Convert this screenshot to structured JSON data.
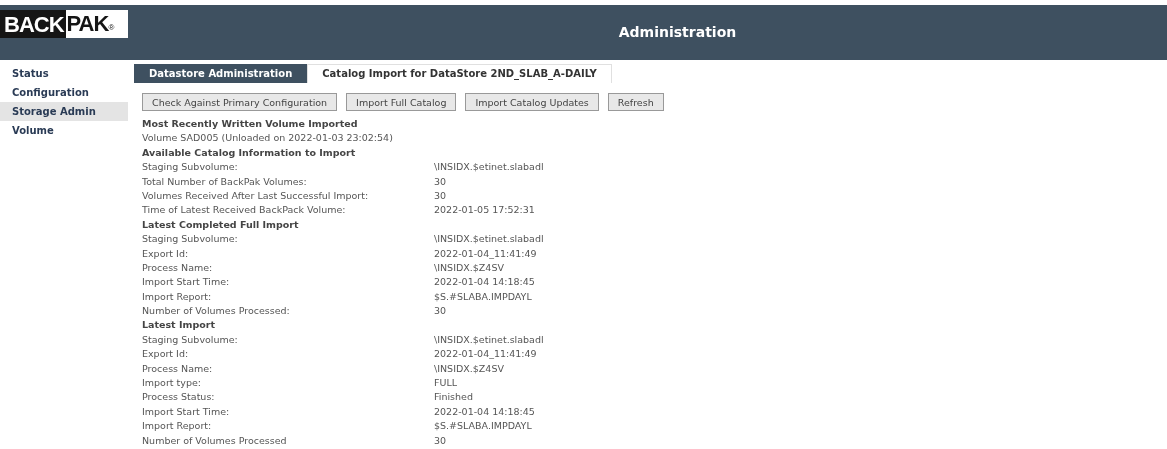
{
  "logo": {
    "part_1": "BACK",
    "part_2": "PAK",
    "mark": "®"
  },
  "header": {
    "title": "Administration"
  },
  "sidebar": {
    "items": [
      {
        "label": "Status",
        "selected": false
      },
      {
        "label": "Configuration",
        "selected": false
      },
      {
        "label": "Storage Admin",
        "selected": true
      },
      {
        "label": "Volume",
        "selected": false
      }
    ]
  },
  "tabs": [
    {
      "label": "Datastore Administration",
      "selected": true
    },
    {
      "label": "Catalog Import for DataStore 2ND_SLAB_A-DAILY",
      "selected": false
    }
  ],
  "buttons": [
    "Check Against Primary Configuration",
    "Import Full Catalog",
    "Import Catalog Updates",
    "Refresh"
  ],
  "sections": [
    {
      "heading": "Most Recently Written Volume Imported",
      "text": "Volume SAD005 (Unloaded on 2022-01-03 23:02:54)"
    },
    {
      "heading": "Available Catalog Information to Import",
      "rows": [
        {
          "label": "Staging Subvolume:",
          "value": "\\INSIDX.$etinet.slabadl"
        },
        {
          "label": "Total Number of BackPak Volumes:",
          "value": "30"
        },
        {
          "label": "Volumes Received After Last Successful Import:",
          "value": "30"
        },
        {
          "label": "Time of Latest Received BackPack Volume:",
          "value": "2022-01-05 17:52:31"
        }
      ]
    },
    {
      "heading": "Latest Completed Full Import",
      "rows": [
        {
          "label": "Staging Subvolume:",
          "value": "\\INSIDX.$etinet.slabadl"
        },
        {
          "label": "Export Id:",
          "value": "2022-01-04_11:41:49"
        },
        {
          "label": "Process Name:",
          "value": "\\INSIDX.$Z4SV"
        },
        {
          "label": "Import Start Time:",
          "value": "2022-01-04 14:18:45"
        },
        {
          "label": "Import Report:",
          "value": "$S.#SLABA.IMPDAYL"
        },
        {
          "label": "Number of Volumes Processed:",
          "value": "30"
        }
      ]
    },
    {
      "heading": "Latest Import",
      "rows": [
        {
          "label": "Staging Subvolume:",
          "value": "\\INSIDX.$etinet.slabadl"
        },
        {
          "label": "Export Id:",
          "value": "2022-01-04_11:41:49"
        },
        {
          "label": "Process Name:",
          "value": "\\INSIDX.$Z4SV"
        },
        {
          "label": "Import type:",
          "value": "FULL"
        },
        {
          "label": "Process Status:",
          "value": "Finished"
        },
        {
          "label": "Import Start Time:",
          "value": "2022-01-04 14:18:45"
        },
        {
          "label": "Import Report:",
          "value": "$S.#SLABA.IMPDAYL"
        },
        {
          "label": "Number of Volumes Processed",
          "value": "30"
        }
      ]
    }
  ]
}
